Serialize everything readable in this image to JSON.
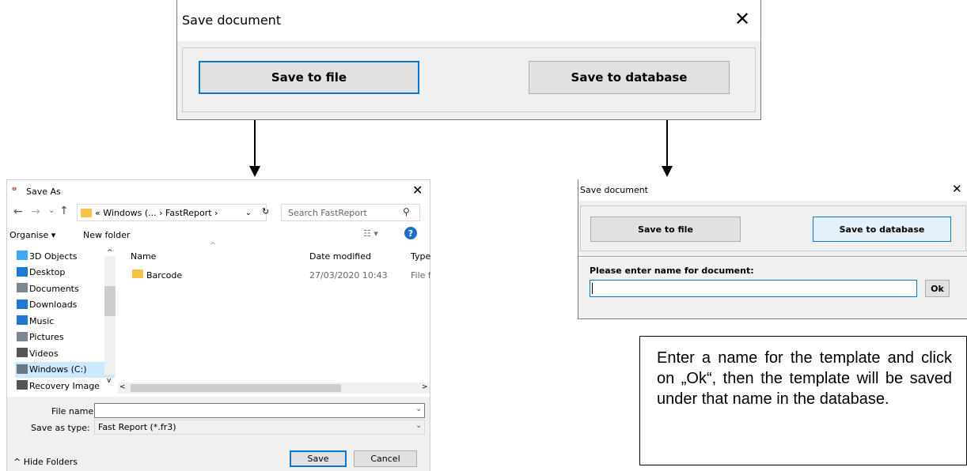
{
  "top_dialog": {
    "title": "Save document",
    "close_glyph": "✕",
    "save_file_label": "Save to file",
    "save_db_label": "Save to database"
  },
  "save_as": {
    "title": "Save As",
    "app_icon": "fastreport-icon",
    "close_glyph": "✕",
    "address_path": "« Windows (... › FastReport ›",
    "search_placeholder": "Search FastReport",
    "organise_label": "Organise ▾",
    "new_folder_label": "New folder",
    "sidebar_items": [
      {
        "label": "3D Objects",
        "icon": "cube-icon",
        "color": "#3fa9f5"
      },
      {
        "label": "Desktop",
        "icon": "desktop-icon",
        "color": "#1e78d4"
      },
      {
        "label": "Documents",
        "icon": "documents-icon",
        "color": "#7b8894"
      },
      {
        "label": "Downloads",
        "icon": "download-icon",
        "color": "#1e78d4"
      },
      {
        "label": "Music",
        "icon": "music-icon",
        "color": "#1e78d4"
      },
      {
        "label": "Pictures",
        "icon": "pictures-icon",
        "color": "#7b8894"
      },
      {
        "label": "Videos",
        "icon": "videos-icon",
        "color": "#555555"
      },
      {
        "label": "Windows (C:)",
        "icon": "drive-icon",
        "color": "#6a7884",
        "selected": true
      },
      {
        "label": "Recovery Image",
        "icon": "drive-icon",
        "color": "#555555"
      }
    ],
    "columns": {
      "name": "Name",
      "date": "Date modified",
      "type": "Type"
    },
    "files": [
      {
        "name": "Barcode",
        "date": "27/03/2020 10:43",
        "type": "File folder"
      }
    ],
    "file_name_label": "File name:",
    "file_name_value": "",
    "save_type_label": "Save as type:",
    "save_type_value": "Fast Report (*.fr3)",
    "hide_folders_label": "^ Hide Folders",
    "save_label": "Save",
    "cancel_label": "Cancel"
  },
  "db_dialog": {
    "title": "Save document",
    "close_glyph": "✕",
    "save_file_label": "Save to file",
    "save_db_label": "Save to database",
    "prompt_label": "Please enter name for document:",
    "name_value": "",
    "ok_label": "Ok"
  },
  "note": {
    "text": "Enter a name for the template and click on „Ok“, then the template will be saved under that name in the database."
  }
}
